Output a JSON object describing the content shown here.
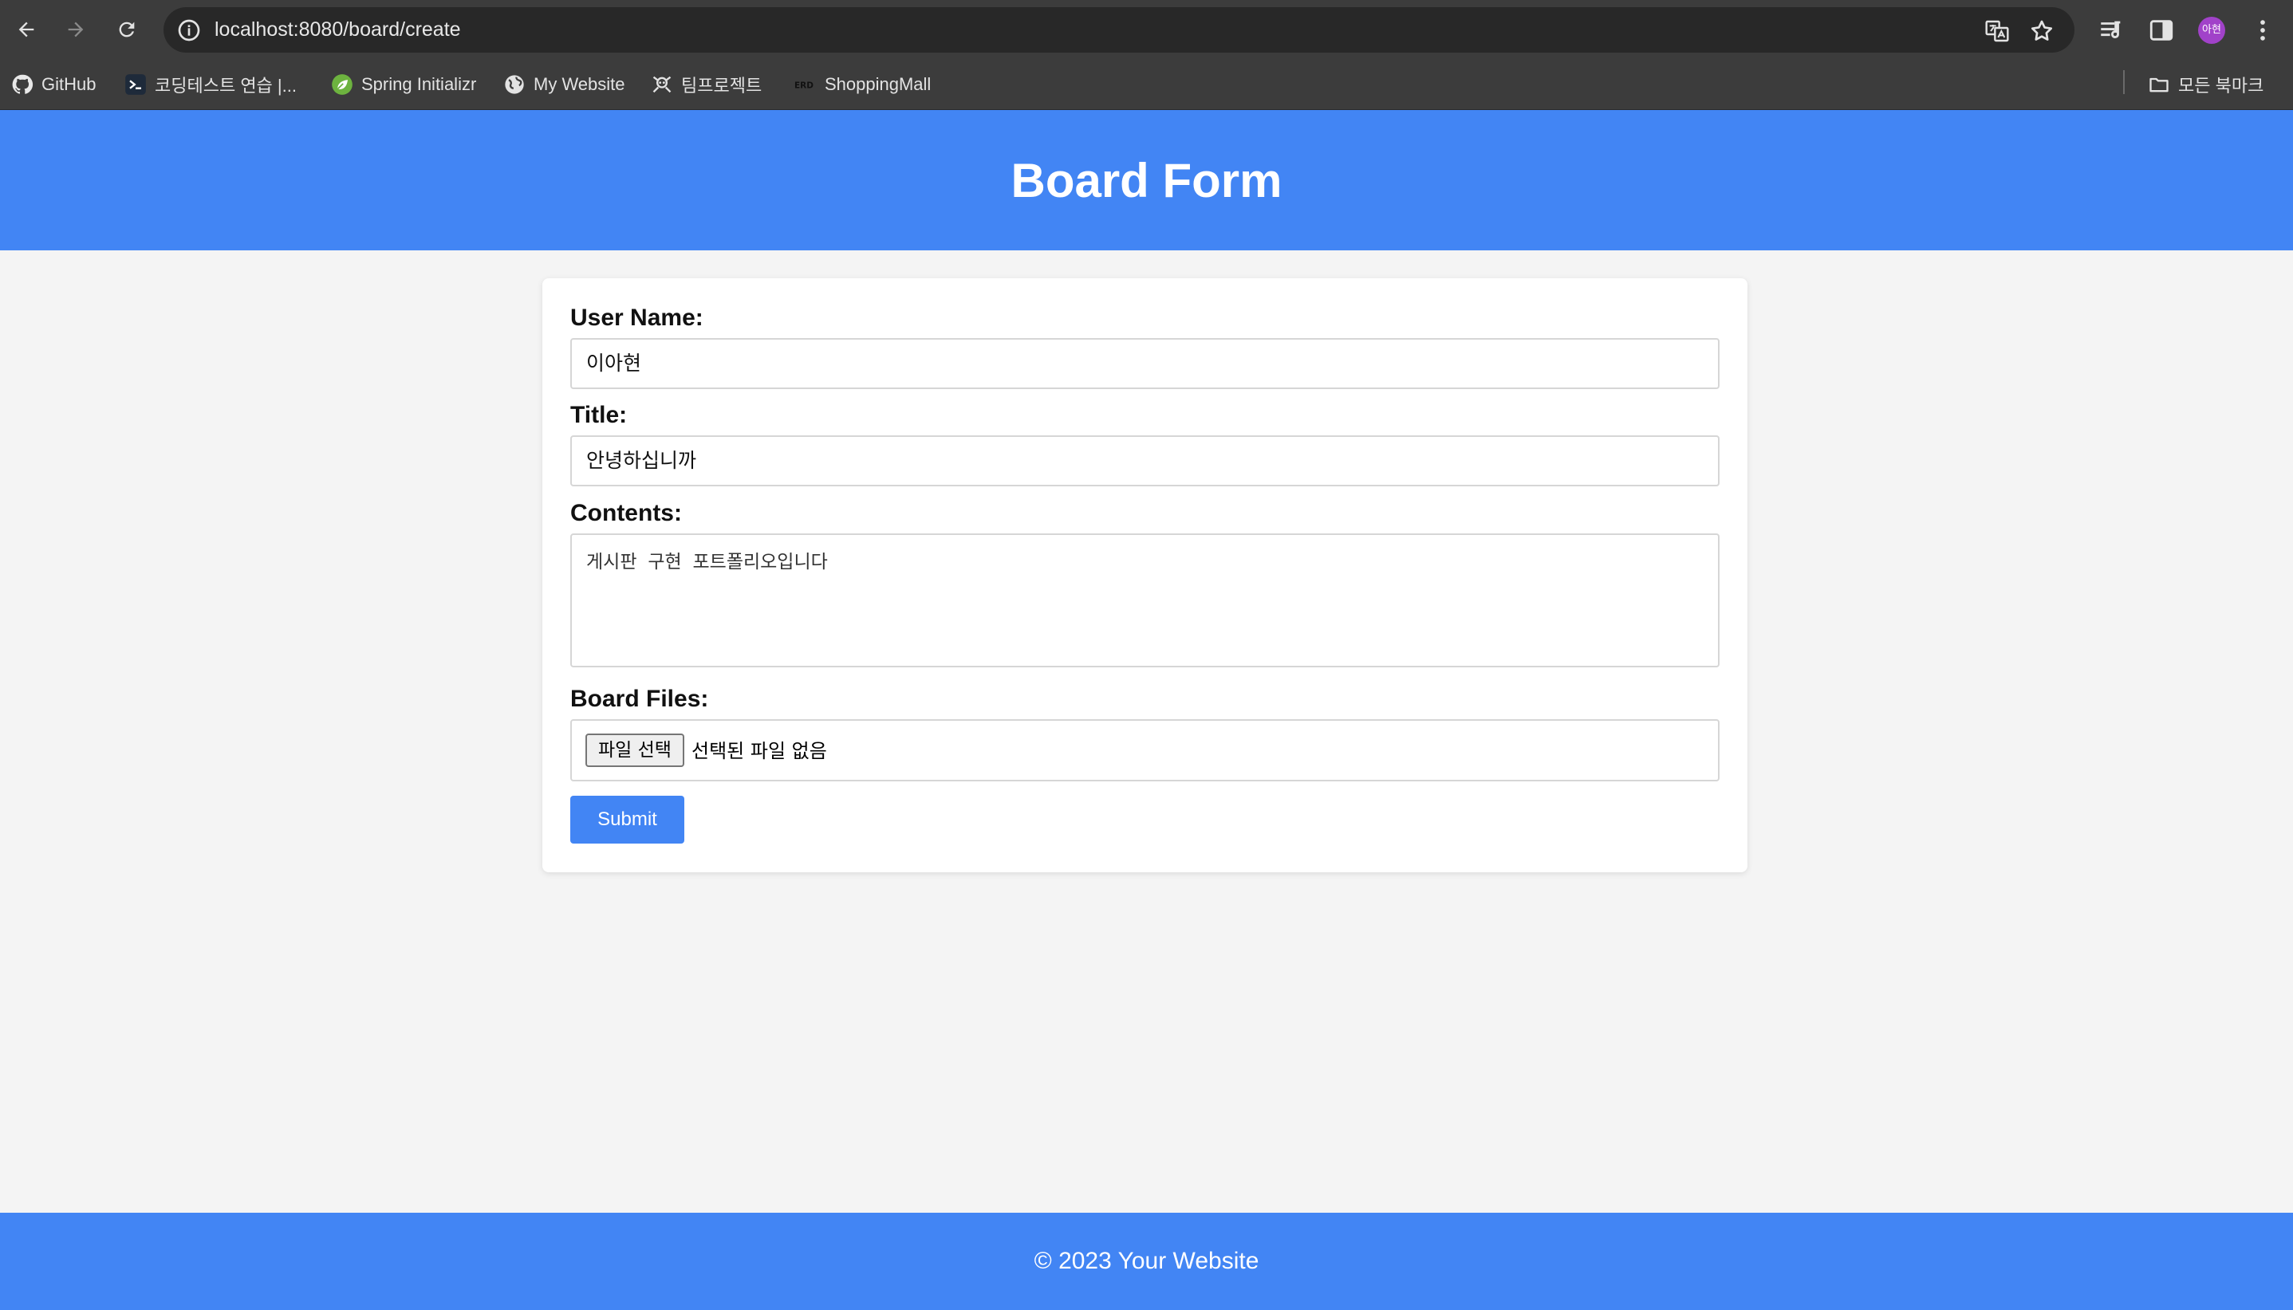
{
  "browser": {
    "url": "localhost:8080/board/create",
    "profile_initial": "아현",
    "bookmarks": [
      {
        "label": "GitHub",
        "icon": "github-icon"
      },
      {
        "label": "코딩테스트 연습 |...",
        "icon": "programmers-icon"
      },
      {
        "label": "Spring Initializr",
        "icon": "spring-leaf-icon"
      },
      {
        "label": "My Website",
        "icon": "globe-icon"
      },
      {
        "label": "팀프로젝트",
        "icon": "project-icon"
      },
      {
        "label": "ShoppingMall",
        "icon": "erd-icon"
      }
    ],
    "all_bookmarks_label": "모든 북마크",
    "erd_icon_text": "ERD"
  },
  "page": {
    "title": "Board Form",
    "footer": "© 2023 Your Website"
  },
  "form": {
    "username_label": "User Name:",
    "username_value": "이아현",
    "title_label": "Title:",
    "title_value": "안녕하십니까",
    "contents_label": "Contents:",
    "contents_value": "게시판 구현 포트폴리오입니다",
    "files_label": "Board Files:",
    "file_button_label": "파일 선택",
    "file_status": "선택된 파일 없음",
    "submit_label": "Submit"
  },
  "colors": {
    "header_bg": "#4285f4",
    "page_bg": "#f4f4f4",
    "chrome_bg": "#3c3c3c"
  }
}
